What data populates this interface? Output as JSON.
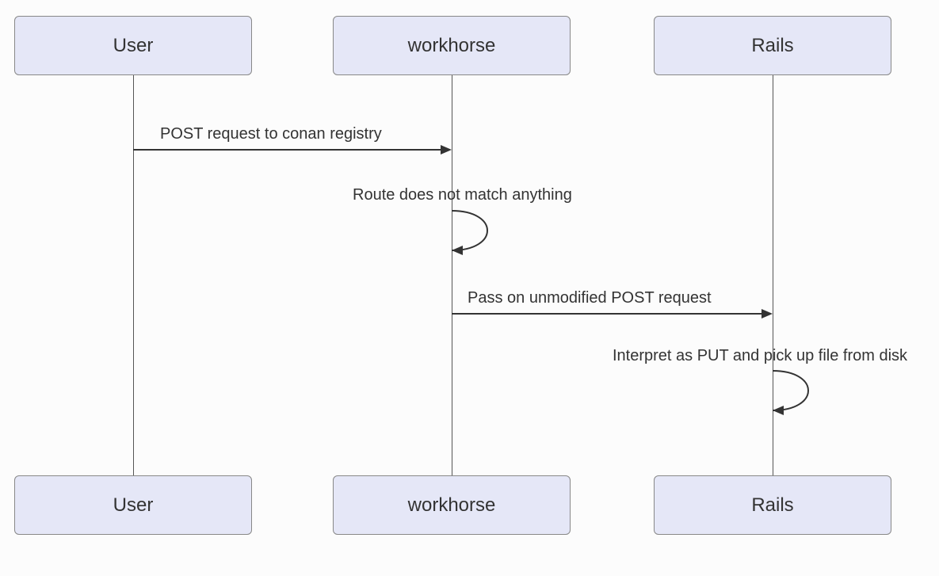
{
  "participants": {
    "user": "User",
    "workhorse": "workhorse",
    "rails": "Rails"
  },
  "messages": {
    "m1": "POST request to conan registry",
    "m2": "Route does not match anything",
    "m3": "Pass on unmodified POST request",
    "m4": "Interpret as PUT and pick up file from disk"
  },
  "chart_data": {
    "type": "sequence_diagram",
    "participants": [
      "User",
      "workhorse",
      "Rails"
    ],
    "interactions": [
      {
        "from": "User",
        "to": "workhorse",
        "label": "POST request to conan registry",
        "kind": "message"
      },
      {
        "from": "workhorse",
        "to": "workhorse",
        "label": "Route does not match anything",
        "kind": "self"
      },
      {
        "from": "workhorse",
        "to": "Rails",
        "label": "Pass on unmodified POST request",
        "kind": "message"
      },
      {
        "from": "Rails",
        "to": "Rails",
        "label": "Interpret as PUT and pick up file from disk",
        "kind": "self"
      }
    ]
  }
}
